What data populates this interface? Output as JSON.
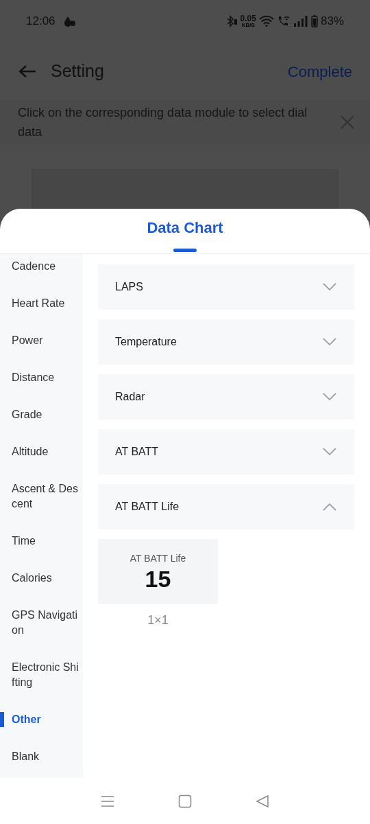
{
  "status_bar": {
    "time": "12:06",
    "net_speed": "0.05",
    "net_unit": "KB/S",
    "battery": "83%"
  },
  "header": {
    "title": "Setting",
    "action": "Complete"
  },
  "banner": {
    "text": "Click on the corresponding data module to select dial data"
  },
  "sheet": {
    "title": "Data Chart",
    "categories": [
      {
        "label": "Cadence",
        "selected": false
      },
      {
        "label": "Heart Rate",
        "selected": false
      },
      {
        "label": "Power",
        "selected": false
      },
      {
        "label": "Distance",
        "selected": false
      },
      {
        "label": "Grade",
        "selected": false
      },
      {
        "label": "Altitude",
        "selected": false
      },
      {
        "label": "Ascent & Descent",
        "selected": false
      },
      {
        "label": "Time",
        "selected": false
      },
      {
        "label": "Calories",
        "selected": false
      },
      {
        "label": "GPS Navigation",
        "selected": false
      },
      {
        "label": "Electronic Shifting",
        "selected": false
      },
      {
        "label": "Other",
        "selected": true
      },
      {
        "label": "Blank",
        "selected": false
      }
    ],
    "groups": [
      {
        "label": "LAPS",
        "expanded": false
      },
      {
        "label": "Temperature",
        "expanded": false
      },
      {
        "label": "Radar",
        "expanded": false
      },
      {
        "label": "AT BATT",
        "expanded": false
      },
      {
        "label": "AT BATT Life",
        "expanded": true,
        "modules": [
          {
            "name": "AT BATT Life",
            "value": "15",
            "size": "1×1"
          }
        ]
      }
    ]
  }
}
